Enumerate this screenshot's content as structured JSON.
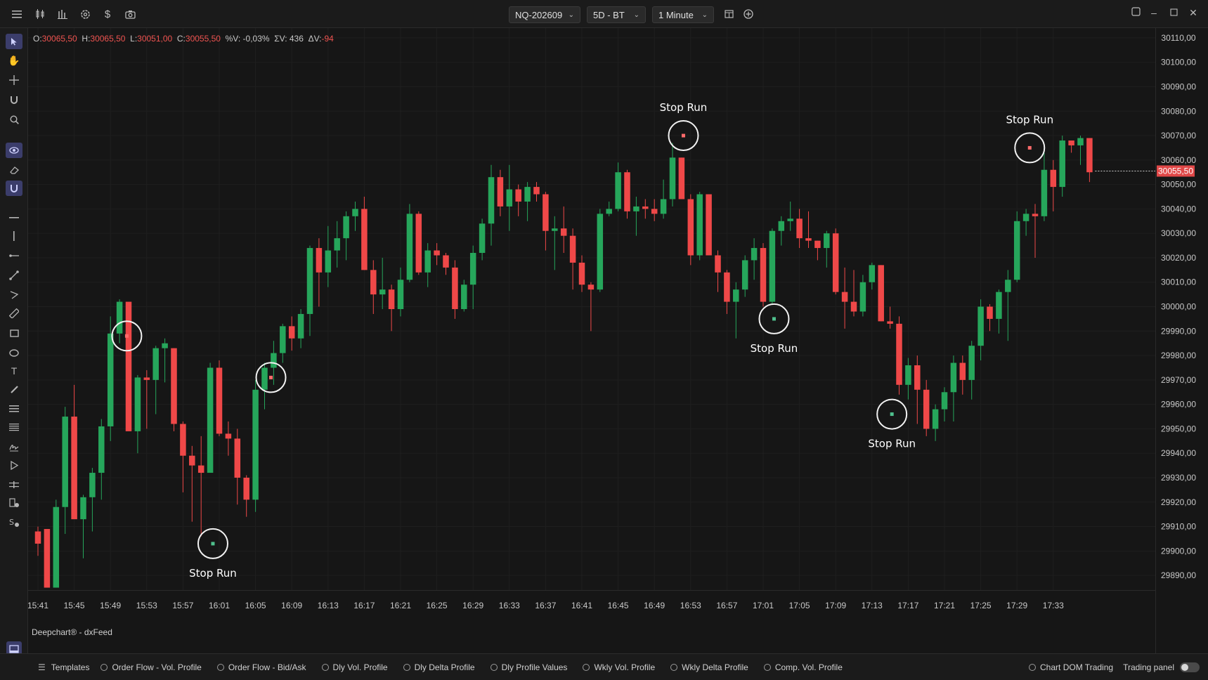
{
  "toolbar": {
    "icons": [
      "menu-icon",
      "candles-icon",
      "bar-chart-icon",
      "settings-icon",
      "dollar-icon",
      "camera-icon"
    ],
    "symbol": "NQ-202609",
    "range": "5D - BT",
    "interval": "1 Minute"
  },
  "ohlc": {
    "o_label": "O:",
    "o": "30065,50",
    "h_label": "H:",
    "h": "30065,50",
    "l_label": "L:",
    "l": "30051,00",
    "c_label": "C:",
    "c": "30055,50",
    "pv": "%V: -0,03%",
    "sv": "ΣV: 436",
    "dv_label": "ΔV:",
    "dv": "-94"
  },
  "watermark": "Deepchart® - dxFeed",
  "colors": {
    "up": "#26a65b",
    "down": "#ef4848",
    "bg": "#161616",
    "grid": "#1f1f1f",
    "price_tag": "#e04848"
  },
  "bottombar": {
    "templates": "Templates",
    "items": [
      "Order Flow - Vol. Profile",
      "Order Flow - Bid/Ask",
      "Dly Vol. Profile",
      "Dly Delta Profile",
      "Dly Profile Values",
      "Wkly Vol. Profile",
      "Wkly Delta Profile",
      "Comp. Vol. Profile"
    ],
    "chart_dom": "Chart DOM Trading",
    "trading_panel": "Trading panel"
  },
  "chart_data": {
    "type": "candlestick",
    "y_ticks": [
      "30110,00",
      "30100,00",
      "30090,00",
      "30080,00",
      "30070,00",
      "30060,00",
      "30050,00",
      "30040,00",
      "30030,00",
      "30020,00",
      "30010,00",
      "30000,00",
      "29990,00",
      "29980,00",
      "29970,00",
      "29960,00",
      "29950,00",
      "29940,00",
      "29930,00",
      "29920,00",
      "29910,00",
      "29900,00",
      "29890,00"
    ],
    "x_ticks": [
      "15:41",
      "15:45",
      "15:49",
      "15:53",
      "15:57",
      "16:01",
      "16:05",
      "16:09",
      "16:13",
      "16:17",
      "16:21",
      "16:25",
      "16:29",
      "16:33",
      "16:37",
      "16:41",
      "16:45",
      "16:49",
      "16:53",
      "16:57",
      "17:01",
      "17:05",
      "17:09",
      "17:13",
      "17:17",
      "17:21",
      "17:25",
      "17:29",
      "17:33"
    ],
    "ylim": [
      29884,
      30114
    ],
    "last_price": 30055.5,
    "last_price_label": "30055,50",
    "candles": [
      [
        29908,
        29910,
        29898,
        29903
      ],
      [
        29909,
        29909,
        29885,
        29885
      ],
      [
        29885,
        29921,
        29885,
        29918
      ],
      [
        29918,
        29959,
        29907,
        29955
      ],
      [
        29955,
        29968,
        29914,
        29913
      ],
      [
        29913,
        29923,
        29897,
        29922
      ],
      [
        29922,
        29934,
        29908,
        29932
      ],
      [
        29932,
        29954,
        29921,
        29951
      ],
      [
        29951,
        29996,
        29945,
        29989
      ],
      [
        29989,
        30003,
        29985,
        30002
      ],
      [
        30002,
        30001,
        29958,
        29949
      ],
      [
        29949,
        29972,
        29940,
        29971
      ],
      [
        29971,
        29974,
        29950,
        29970
      ],
      [
        29970,
        29984,
        29956,
        29983
      ],
      [
        29983,
        29987,
        29969,
        29985
      ],
      [
        29983,
        29983,
        29949,
        29952
      ],
      [
        29952,
        29953,
        29924,
        29939
      ],
      [
        29939,
        29943,
        29912,
        29935
      ],
      [
        29935,
        29947,
        29906,
        29932
      ],
      [
        29932,
        29977,
        29932,
        29975
      ],
      [
        29975,
        29978,
        29947,
        29948
      ],
      [
        29948,
        29953,
        29939,
        29946
      ],
      [
        29946,
        29950,
        29919,
        29930
      ],
      [
        29930,
        29931,
        29914,
        29921
      ],
      [
        29921,
        29970,
        29916,
        29966
      ],
      [
        29966,
        29977,
        29958,
        29975
      ],
      [
        29975,
        29986,
        29968,
        29981
      ],
      [
        29981,
        29993,
        29977,
        29992
      ],
      [
        29992,
        29996,
        29982,
        29987
      ],
      [
        29987,
        29999,
        29983,
        29997
      ],
      [
        29997,
        30025,
        29988,
        30024
      ],
      [
        30024,
        30028,
        30000,
        30014
      ],
      [
        30014,
        30033,
        30008,
        30023
      ],
      [
        30023,
        30035,
        30016,
        30028
      ],
      [
        30028,
        30039,
        30019,
        30037
      ],
      [
        30037,
        30043,
        30031,
        30040
      ],
      [
        30040,
        30045,
        30015,
        30015
      ],
      [
        30015,
        30019,
        29997,
        30005
      ],
      [
        30005,
        30020,
        29999,
        30007
      ],
      [
        30007,
        30009,
        29990,
        29999
      ],
      [
        29999,
        30016,
        29996,
        30011
      ],
      [
        30011,
        30042,
        30010,
        30038
      ],
      [
        30038,
        30039,
        30013,
        30014
      ],
      [
        30014,
        30026,
        30008,
        30023
      ],
      [
        30023,
        30026,
        30017,
        30021
      ],
      [
        30021,
        30022,
        30013,
        30016
      ],
      [
        30016,
        30019,
        29995,
        29999
      ],
      [
        29999,
        30011,
        29998,
        30009
      ],
      [
        30009,
        30025,
        29999,
        30022
      ],
      [
        30022,
        30036,
        30019,
        30034
      ],
      [
        30034,
        30058,
        30025,
        30053
      ],
      [
        30053,
        30056,
        30037,
        30041
      ],
      [
        30041,
        30058,
        30031,
        30048
      ],
      [
        30048,
        30050,
        30037,
        30043
      ],
      [
        30043,
        30051,
        30035,
        30049
      ],
      [
        30049,
        30051,
        30043,
        30046
      ],
      [
        30046,
        30047,
        30023,
        30031
      ],
      [
        30031,
        30037,
        30015,
        30032
      ],
      [
        30032,
        30041,
        30022,
        30029
      ],
      [
        30029,
        30032,
        30007,
        30018
      ],
      [
        30018,
        30021,
        30006,
        30009
      ],
      [
        30009,
        30010,
        29990,
        30007
      ],
      [
        30007,
        30040,
        30006,
        30038
      ],
      [
        30038,
        30043,
        30037,
        30040
      ],
      [
        30040,
        30059,
        30039,
        30055
      ],
      [
        30055,
        30056,
        30036,
        30039
      ],
      [
        30039,
        30045,
        30029,
        30041
      ],
      [
        30041,
        30044,
        30036,
        30040
      ],
      [
        30040,
        30044,
        30035,
        30038
      ],
      [
        30038,
        30052,
        30036,
        30044
      ],
      [
        30044,
        30067,
        30041,
        30061
      ],
      [
        30061,
        30061,
        30044,
        30044
      ],
      [
        30044,
        30046,
        30017,
        30021
      ],
      [
        30021,
        30047,
        30019,
        30046
      ],
      [
        30046,
        30046,
        30021,
        30021
      ],
      [
        30021,
        30023,
        30006,
        30014
      ],
      [
        30014,
        30015,
        29997,
        30002
      ],
      [
        30002,
        30010,
        29987,
        30007
      ],
      [
        30007,
        30021,
        30004,
        30019
      ],
      [
        30019,
        30028,
        30011,
        30024
      ],
      [
        30024,
        30026,
        30000,
        30002
      ],
      [
        30002,
        30032,
        30001,
        30031
      ],
      [
        30031,
        30037,
        30025,
        30035
      ],
      [
        30035,
        30043,
        30031,
        30036
      ],
      [
        30036,
        30040,
        30024,
        30028
      ],
      [
        30028,
        30039,
        30024,
        30027
      ],
      [
        30027,
        30027,
        30019,
        30024
      ],
      [
        30024,
        30031,
        30016,
        30030
      ],
      [
        30030,
        30032,
        30005,
        30006
      ],
      [
        30006,
        30016,
        29991,
        30002
      ],
      [
        30002,
        30015,
        29996,
        29998
      ],
      [
        29998,
        30013,
        29996,
        30010
      ],
      [
        30010,
        30018,
        30007,
        30017
      ],
      [
        30017,
        30017,
        29994,
        29994
      ],
      [
        29994,
        30000,
        29991,
        29993
      ],
      [
        29993,
        29996,
        29964,
        29968
      ],
      [
        29968,
        29979,
        29962,
        29976
      ],
      [
        29976,
        29980,
        29952,
        29966
      ],
      [
        29966,
        29970,
        29947,
        29950
      ],
      [
        29950,
        29960,
        29945,
        29958
      ],
      [
        29958,
        29967,
        29953,
        29965
      ],
      [
        29965,
        29980,
        29953,
        29977
      ],
      [
        29977,
        29980,
        29964,
        29970
      ],
      [
        29970,
        29986,
        29962,
        29984
      ],
      [
        29984,
        30003,
        29978,
        30000
      ],
      [
        30000,
        30001,
        29990,
        29995
      ],
      [
        29995,
        30007,
        29989,
        30006
      ],
      [
        30006,
        30015,
        29986,
        30011
      ],
      [
        30011,
        30039,
        30010,
        30035
      ],
      [
        30035,
        30040,
        30029,
        30038
      ],
      [
        30038,
        30042,
        30020,
        30037
      ],
      [
        30037,
        30063,
        30035,
        30056
      ],
      [
        30056,
        30060,
        30039,
        30049
      ],
      [
        30049,
        30070,
        30045,
        30068
      ],
      [
        30068,
        30068,
        30063,
        30066
      ],
      [
        30066,
        30070,
        30058,
        30069
      ],
      [
        30069,
        30069,
        30051,
        30055
      ]
    ],
    "annotations": [
      {
        "label": "Stop Run",
        "x_index": 9.8,
        "price": 29988,
        "circle_r": 21,
        "label_pos": "none",
        "dot": "down"
      },
      {
        "label": "Stop Run",
        "x_index": 19.3,
        "price": 29903,
        "circle_r": 21,
        "label_pos": "below",
        "dot": "up"
      },
      {
        "label": "Stop Run",
        "x_index": 25.7,
        "price": 29971,
        "circle_r": 21,
        "label_pos": "none",
        "dot": "down"
      },
      {
        "label": "Stop Run",
        "x_index": 71.2,
        "price": 30070,
        "circle_r": 21,
        "label_pos": "above",
        "dot": "down"
      },
      {
        "label": "Stop Run",
        "x_index": 81.2,
        "price": 29995,
        "circle_r": 21,
        "label_pos": "below",
        "dot": "up"
      },
      {
        "label": "Stop Run",
        "x_index": 94.2,
        "price": 29956,
        "circle_r": 21,
        "label_pos": "below",
        "dot": "up"
      },
      {
        "label": "Stop Run",
        "x_index": 109.4,
        "price": 30065,
        "circle_r": 21,
        "label_pos": "above",
        "dot": "down"
      }
    ]
  }
}
